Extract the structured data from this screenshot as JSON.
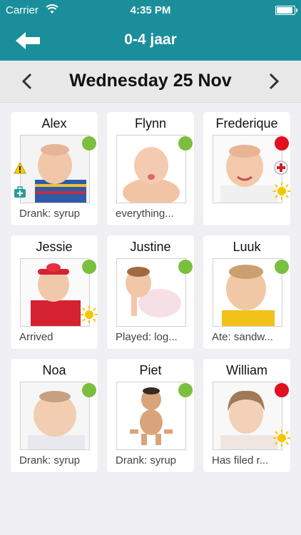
{
  "status": {
    "carrier": "Carrier",
    "time": "4:35 PM"
  },
  "nav": {
    "title": "0-4 jaar",
    "back_icon": "back-arrow-icon"
  },
  "date": {
    "label": "Wednesday 25 Nov"
  },
  "colors": {
    "header": "#1a8f9b",
    "present": "#7bbf3f",
    "absent": "#e01020"
  },
  "children": [
    {
      "name": "Alex",
      "status": "present",
      "caption": "Drank: syrup"
    },
    {
      "name": "Flynn",
      "status": "present",
      "caption": "everything..."
    },
    {
      "name": "Frederique",
      "status": "absent",
      "caption": ""
    },
    {
      "name": "Jessie",
      "status": "present",
      "caption": "Arrived"
    },
    {
      "name": "Justine",
      "status": "present",
      "caption": "Played: log..."
    },
    {
      "name": "Luuk",
      "status": "present",
      "caption": "Ate: sandw..."
    },
    {
      "name": "Noa",
      "status": "present",
      "caption": "Drank: syrup"
    },
    {
      "name": "Piet",
      "status": "present",
      "caption": "Drank: syrup"
    },
    {
      "name": "William",
      "status": "absent",
      "caption": "Has filed r..."
    }
  ]
}
